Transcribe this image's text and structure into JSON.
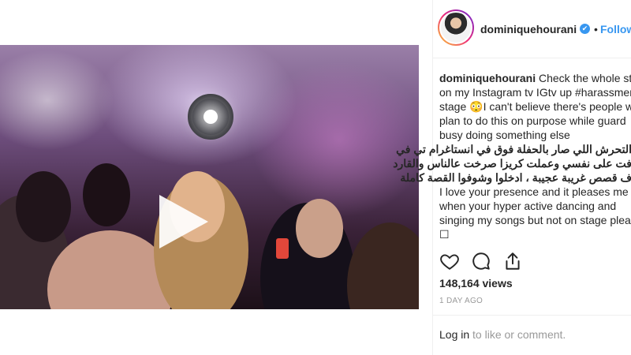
{
  "post": {
    "username": "dominiquehourani",
    "follow_label": "Follow",
    "dot": "•",
    "verified_glyph": "✔",
    "caption_lines": [
      "Check the whole story",
      "on my Instagram tv IGtv up #harassment",
      "stage 😳I can't believe there's people who",
      "plan to do this on purpose while guard",
      "busy doing something else"
    ],
    "caption_arabic": [
      "التحرش اللي صار بالحفلة فوق في انستاغرام تي في",
      "فت على نفسي وعملت كريزا صرخت عالناس والقارد",
      "ف قصص غريبة عجيبة ، ادخلوا وشوفوا القصة كاملة"
    ],
    "caption_english_2": [
      "I love your presence and it pleases me",
      "when your hyper active dancing and",
      "singing my songs but not on stage please",
      "☐"
    ],
    "views": "148,164 views",
    "time": "1 DAY AGO",
    "login_link": "Log in",
    "login_rest": " to like or comment."
  },
  "icons": {
    "like": "heart-icon",
    "comment": "comment-icon",
    "share": "share-icon",
    "play": "play-icon"
  },
  "colors": {
    "link_blue": "#3897f0",
    "text": "#262626",
    "muted": "#999999",
    "divider": "#efefef"
  }
}
